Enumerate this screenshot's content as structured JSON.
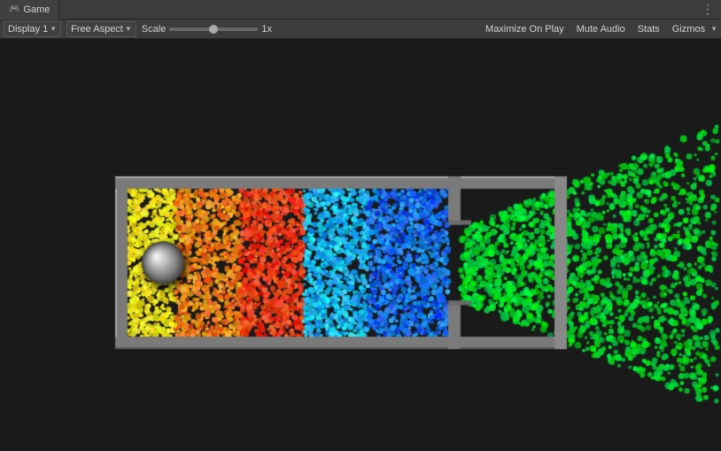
{
  "tab": {
    "icon": "🎮",
    "label": "Game"
  },
  "toolbar": {
    "display_label": "Display 1",
    "aspect_label": "Free Aspect",
    "scale_label": "Scale",
    "scale_value": "1x",
    "maximize_label": "Maximize On Play",
    "mute_label": "Mute Audio",
    "stats_label": "Stats",
    "gizmos_label": "Gizmos",
    "more_icon": "⋮"
  }
}
